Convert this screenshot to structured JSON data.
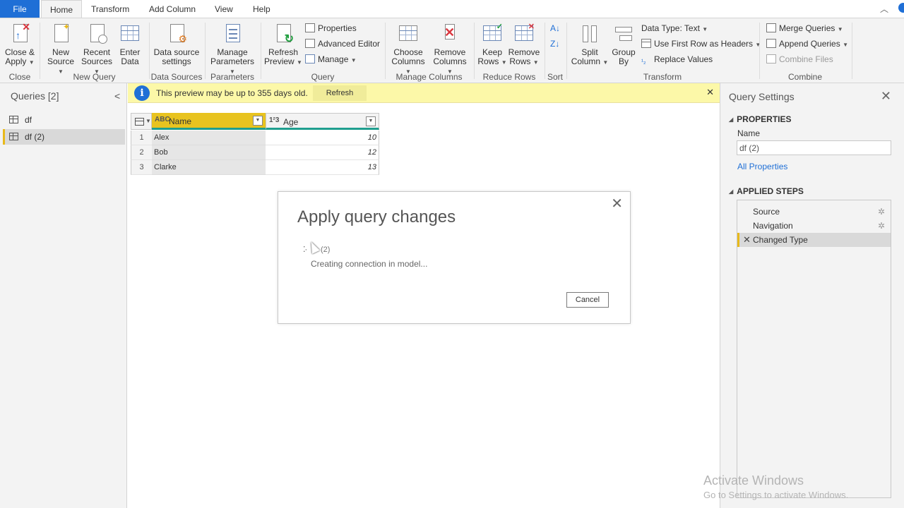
{
  "menu": {
    "tabs": [
      "File",
      "Home",
      "Transform",
      "Add Column",
      "View",
      "Help"
    ]
  },
  "ribbon": {
    "close": {
      "label": "Close &",
      "label2": "Apply",
      "group": "Close"
    },
    "new_query": {
      "group": "New Query",
      "new_source": [
        "New",
        "Source"
      ],
      "recent_sources": [
        "Recent",
        "Sources"
      ],
      "enter_data": [
        "Enter",
        "Data"
      ]
    },
    "data_sources": {
      "group": "Data Sources",
      "label": [
        "Data source",
        "settings"
      ]
    },
    "parameters": {
      "group": "Parameters",
      "label": [
        "Manage",
        "Parameters"
      ]
    },
    "query": {
      "group": "Query",
      "refresh": [
        "Refresh",
        "Preview"
      ],
      "properties": "Properties",
      "advanced_editor": "Advanced Editor",
      "manage": "Manage"
    },
    "manage_columns": {
      "group": "Manage Columns",
      "choose": [
        "Choose",
        "Columns"
      ],
      "remove": [
        "Remove",
        "Columns"
      ]
    },
    "reduce_rows": {
      "group": "Reduce Rows",
      "keep": [
        "Keep",
        "Rows"
      ],
      "remove": [
        "Remove",
        "Rows"
      ]
    },
    "sort": {
      "group": "Sort"
    },
    "transform": {
      "group": "Transform",
      "split": [
        "Split",
        "Column"
      ],
      "group_by": [
        "Group",
        "By"
      ],
      "data_type": "Data Type: Text",
      "first_row": "Use First Row as Headers",
      "replace": "Replace Values"
    },
    "combine": {
      "group": "Combine",
      "merge": "Merge Queries",
      "append": "Append Queries",
      "combine_files": "Combine Files"
    }
  },
  "queries_pane": {
    "title": "Queries [2]",
    "items": [
      {
        "label": "df"
      },
      {
        "label": "df (2)"
      }
    ]
  },
  "infobar": {
    "message": "This preview may be up to 355 days old.",
    "refresh": "Refresh"
  },
  "table": {
    "columns": [
      {
        "type": "ABC",
        "name": "Name"
      },
      {
        "type": "1²3",
        "name": "Age"
      }
    ],
    "rows": [
      {
        "n": "1",
        "name": "Alex",
        "age": "10"
      },
      {
        "n": "2",
        "name": "Bob",
        "age": "12"
      },
      {
        "n": "3",
        "name": "Clarke",
        "age": "13"
      }
    ]
  },
  "dialog": {
    "title": "Apply query changes",
    "query_name": "(2)",
    "status": "Creating connection in model...",
    "cancel": "Cancel"
  },
  "settings": {
    "title": "Query Settings",
    "properties_header": "PROPERTIES",
    "name_label": "Name",
    "name_value": "df (2)",
    "all_properties": "All Properties",
    "steps_header": "APPLIED STEPS",
    "steps": [
      "Source",
      "Navigation",
      "Changed Type"
    ]
  },
  "watermark": {
    "line1": "Activate Windows",
    "line2": "Go to Settings to activate Windows."
  },
  "colors": {
    "accent_blue": "#1f6fd6",
    "name_col_yellow": "#e8c31f",
    "teal_underline": "#1f9e8e",
    "infobar_yellow": "#fcf8a8",
    "selection_yellow": "#e8b91a"
  }
}
